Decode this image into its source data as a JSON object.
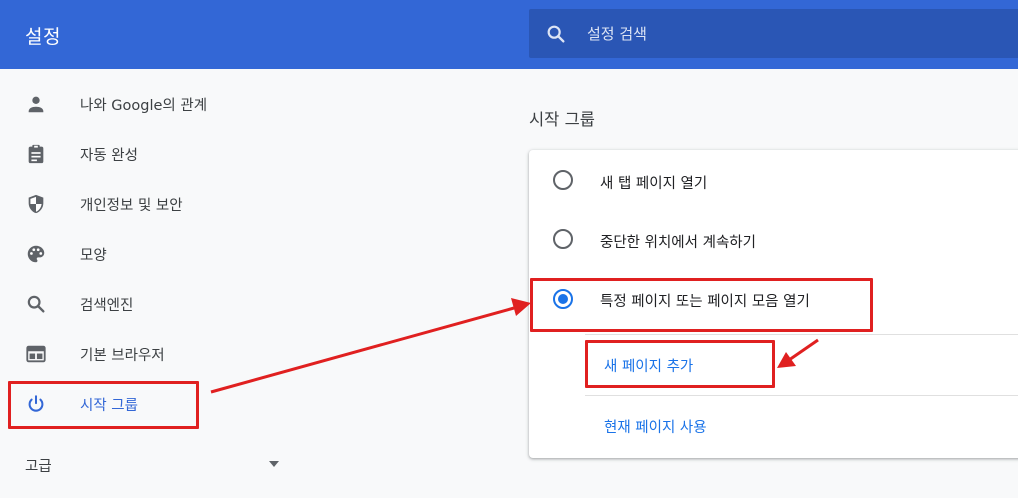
{
  "header": {
    "title": "설정",
    "search_placeholder": "설정 검색",
    "search_icon": "search-icon"
  },
  "sidebar": {
    "items": [
      {
        "label": "나와 Google의 관계",
        "icon": "person-icon",
        "active": false
      },
      {
        "label": "자동 완성",
        "icon": "clipboard-icon",
        "active": false
      },
      {
        "label": "개인정보 및 보안",
        "icon": "shield-icon",
        "active": false
      },
      {
        "label": "모양",
        "icon": "palette-icon",
        "active": false
      },
      {
        "label": "검색엔진",
        "icon": "search-icon",
        "active": false
      },
      {
        "label": "기본 브라우저",
        "icon": "browser-icon",
        "active": false
      },
      {
        "label": "시작 그룹",
        "icon": "power-icon",
        "active": true
      }
    ],
    "advanced_label": "고급",
    "advanced_icon": "caret-down-icon"
  },
  "main": {
    "section_title": "시작 그룹",
    "options": [
      {
        "label": "새 탭 페이지 열기",
        "checked": false
      },
      {
        "label": "중단한 위치에서 계속하기",
        "checked": false
      },
      {
        "label": "특정 페이지 또는 페이지 모음 열기",
        "checked": true
      }
    ],
    "add_page_link": "새 페이지 추가",
    "use_current_link": "현재 페이지 사용"
  },
  "colors": {
    "header_bg": "#3367d6",
    "search_bg": "#2a56b5",
    "accent": "#1a73e8",
    "active_nav": "#3367d6",
    "annotation_red": "#e02020"
  }
}
